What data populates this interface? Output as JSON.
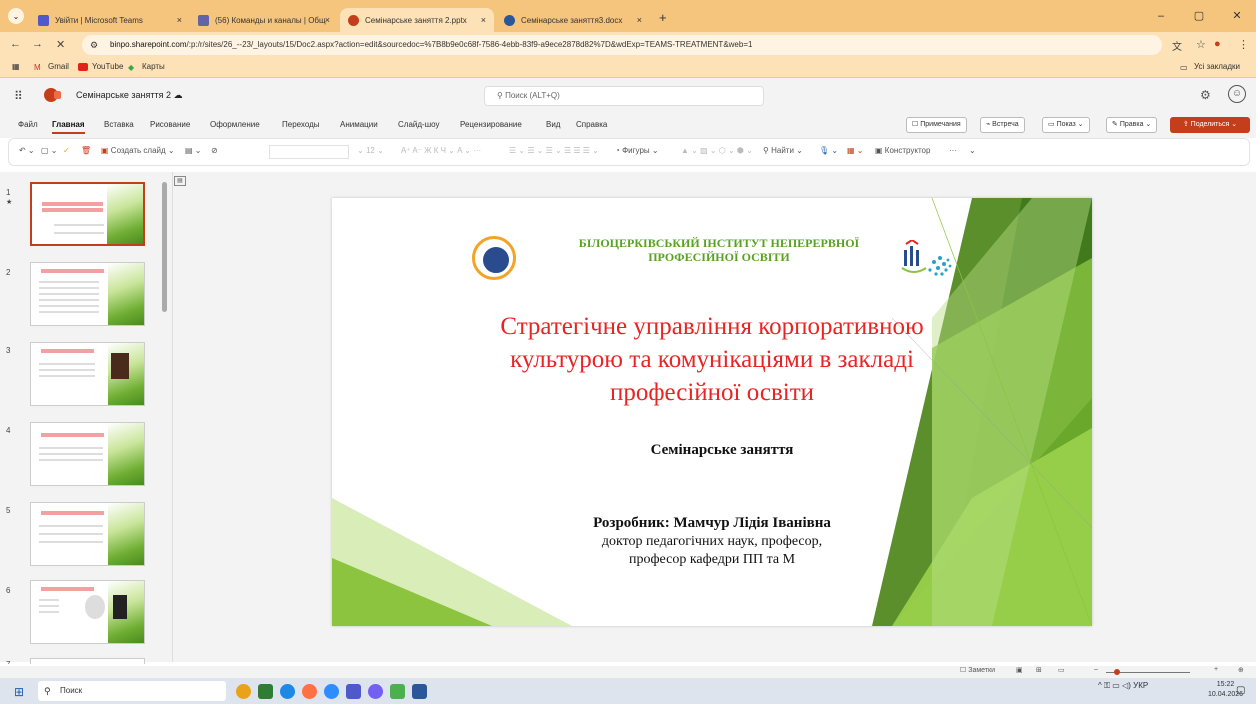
{
  "browser": {
    "tabs": [
      {
        "label": "Увійти | Microsoft Teams",
        "color": "#5059c9"
      },
      {
        "label": "(56) Команды и каналы | Общ",
        "color": "#6264a7"
      },
      {
        "label": "Семінарське заняття 2.pptx",
        "color": "#c43e1c"
      },
      {
        "label": "Семінарське заняття3.docx",
        "color": "#2b579a"
      }
    ],
    "tab_close": "×",
    "new_tab": "+",
    "window_buttons": [
      "–",
      "▢",
      "✕"
    ],
    "url_host": "binpo.sharepoint.com",
    "url_path": "/:p:/r/sites/26_--23/_layouts/15/Doc2.aspx?action=edit&sourcedoc=%7B8b9e0c68f-7586-4ebb-83f9-a9ece2878d82%7D&wdExp=TEAMS-TREATMENT&web=1",
    "nav_icons": [
      "←",
      "→",
      "✕"
    ],
    "bookmarks": [
      "Gmail",
      "YouTube",
      "Карты"
    ],
    "all_bookmarks": "Усі закладки"
  },
  "app": {
    "doc_name": "Семінарське заняття 2",
    "search_placeholder": "Поиск (ALT+Q)",
    "menu": [
      "Файл",
      "Главная",
      "Вставка",
      "Рисование",
      "Оформление",
      "Переходы",
      "Анимации",
      "Слайд-шоу",
      "Рецензирование",
      "Вид",
      "Справка"
    ],
    "active_menu": "Главная",
    "right_buttons": [
      "Примечания",
      "Встреча",
      "Показ",
      "Правка"
    ],
    "share": "Поделиться",
    "toolbar": {
      "new_slide": "Создать слайд",
      "font_size": "12",
      "shapes": "Фигуры",
      "find": "Найти",
      "designer": "Конструктор"
    }
  },
  "thumbnails": [
    {
      "num": "1",
      "selected": true
    },
    {
      "num": "2",
      "selected": false
    },
    {
      "num": "3",
      "selected": false
    },
    {
      "num": "4",
      "selected": false
    },
    {
      "num": "5",
      "selected": false
    },
    {
      "num": "6",
      "selected": false
    },
    {
      "num": "7",
      "selected": false
    }
  ],
  "slide": {
    "institute_line1": "БІЛОЦЕРКІВСЬКИЙ ІНСТИТУТ НЕПЕРЕРВНОЇ",
    "institute_line2": "ПРОФЕСІЙНОЇ ОСВІТИ",
    "title_line1": "Стратегічне управління корпоративною",
    "title_line2": "культурою та комунікаціями в закладі",
    "title_line3": "професійної освіти",
    "subtitle": "Семінарське заняття",
    "author_name": "Розробник: Мамчур Лідія Іванівна",
    "author_degree": "доктор педагогічних наук, професор,",
    "author_position": "професор кафедри ПП та М",
    "title_color": "#e82424",
    "institute_color": "#58a21f"
  },
  "statusbar": {
    "notes": "Заметки",
    "zoom_plus": "+",
    "zoom_minus": "–"
  },
  "taskbar": {
    "search": "Поиск",
    "language": "УКР",
    "time": "15:22",
    "date": "10.04.2026"
  }
}
